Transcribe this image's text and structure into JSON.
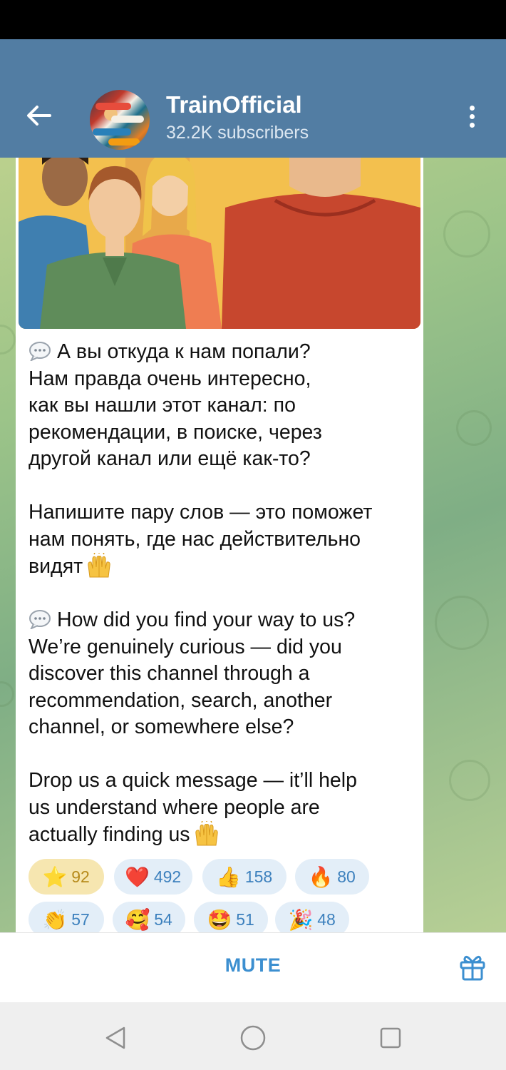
{
  "header": {
    "back_icon": "arrow-left-icon",
    "channel_name": "TrainOfficial",
    "subscribers": "32.2K subscribers",
    "menu_icon": "more-vertical-icon"
  },
  "message": {
    "ru_paragraph_1_lines": [
      "А вы откуда к нам попали?",
      "Нам правда очень интересно,",
      "как вы нашли этот канал: по",
      "рекомендации, в поиске, через",
      "другой канал или ещё как-то?"
    ],
    "ru_paragraph_2_lines": [
      "Напишите пару слов — это поможет",
      "нам понять, где нас действительно",
      "видят"
    ],
    "en_paragraph_1_lines": [
      "How did you find your way to us?",
      "We’re genuinely curious — did you",
      "discover this channel through a",
      "recommendation, search, another",
      "channel, or somewhere else?"
    ],
    "en_paragraph_2_lines": [
      "Drop us a quick message — it’ll help",
      "us understand where people are",
      "actually finding us"
    ]
  },
  "reactions": [
    {
      "emoji": "⭐",
      "icon": "star-icon",
      "count": "92",
      "selected": true
    },
    {
      "emoji": "❤️",
      "icon": "heart-icon",
      "count": "492"
    },
    {
      "emoji": "👍",
      "icon": "thumbs-up-icon",
      "count": "158"
    },
    {
      "emoji": "🔥",
      "icon": "fire-icon",
      "count": "80"
    },
    {
      "emoji": "👏",
      "icon": "clap-icon",
      "count": "57"
    },
    {
      "emoji": "🥰",
      "icon": "smiling-hearts-icon",
      "count": "54"
    },
    {
      "emoji": "🤩",
      "icon": "star-struck-icon",
      "count": "51"
    },
    {
      "emoji": "🎉",
      "icon": "party-popper-icon",
      "count": "48"
    }
  ],
  "bottom_bar": {
    "mute_label": "MUTE",
    "gift_icon": "gift-icon"
  },
  "colors": {
    "header_bg": "#527da3",
    "accent": "#3c8fd0",
    "reaction_bg": "#e3eef8",
    "reaction_selected_bg": "#f6e6b0"
  }
}
